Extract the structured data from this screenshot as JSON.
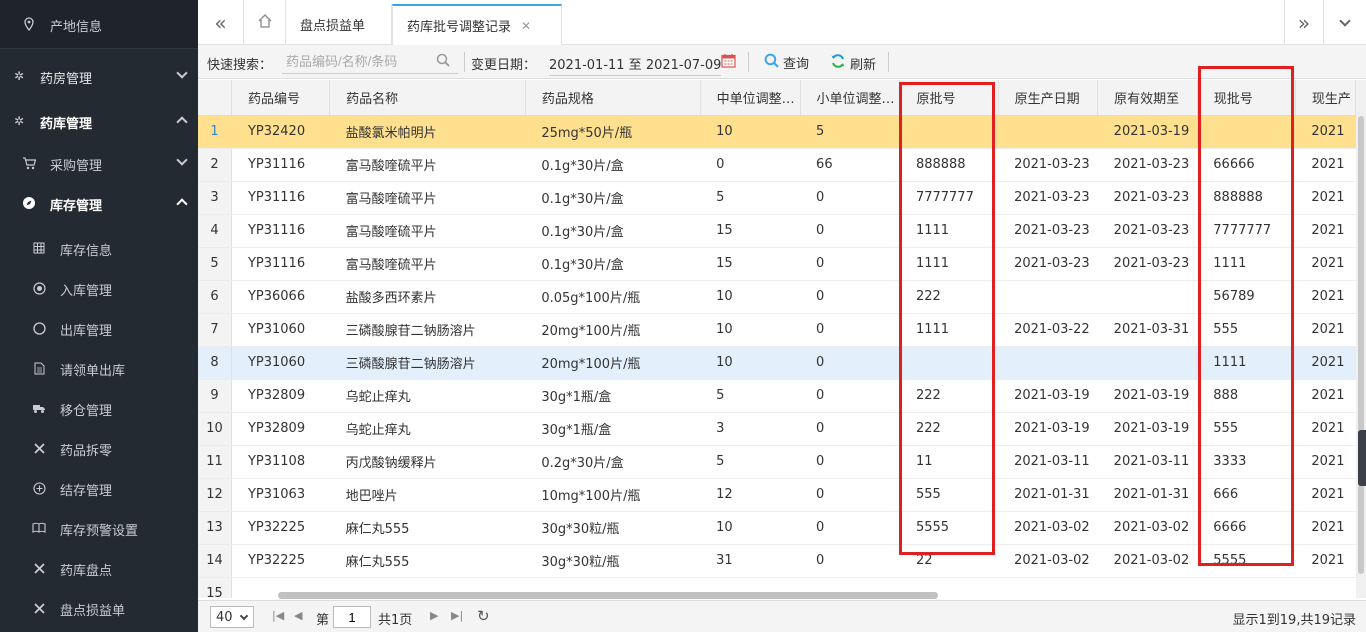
{
  "sidebar": {
    "top_item": "产地信息",
    "pharmacy": "药房管理",
    "warehouse": "药库管理",
    "purchase": "采购管理",
    "inventory": "库存管理",
    "children": [
      {
        "label": "库存信息",
        "icon": "grid-icon"
      },
      {
        "label": "入库管理",
        "icon": "radio-dot-icon"
      },
      {
        "label": "出库管理",
        "icon": "circle-icon"
      },
      {
        "label": "请领单出库",
        "icon": "document-icon"
      },
      {
        "label": "移仓管理",
        "icon": "truck-icon"
      },
      {
        "label": "药品拆零",
        "icon": "tools-icon"
      },
      {
        "label": "结存管理",
        "icon": "plus-circle-icon"
      },
      {
        "label": "库存预警设置",
        "icon": "book-icon"
      },
      {
        "label": "药库盘点",
        "icon": "tools-icon"
      },
      {
        "label": "盘点损益单",
        "icon": "tools-icon"
      }
    ]
  },
  "tabs": {
    "items": [
      "盘点损益单",
      "药库批号调整记录"
    ],
    "active": 1
  },
  "toolbar": {
    "search_label": "快速搜索：",
    "search_placeholder": "药品编码/名称/条码",
    "date_label": "变更日期：",
    "date_value": "2021-01-11 至 2021-07-09",
    "query": "查询",
    "refresh": "刷新"
  },
  "grid": {
    "columns": [
      "药品编号",
      "药品名称",
      "药品规格",
      "中单位调整…",
      "小单位调整…",
      "原批号",
      "原生产日期",
      "原有效期至",
      "现批号",
      "现生产"
    ],
    "rows": [
      {
        "n": "1",
        "cells": [
          "YP32420",
          "盐酸氯米帕明片",
          "25mg*50片/瓶",
          "10",
          "5",
          "",
          "",
          "2021-03-19",
          "",
          "2021"
        ]
      },
      {
        "n": "2",
        "cells": [
          "YP31116",
          "富马酸喹硫平片",
          "0.1g*30片/盒",
          "0",
          "66",
          "888888",
          "2021-03-23",
          "2021-03-23",
          "66666",
          "2021"
        ]
      },
      {
        "n": "3",
        "cells": [
          "YP31116",
          "富马酸喹硫平片",
          "0.1g*30片/盒",
          "5",
          "0",
          "7777777",
          "2021-03-23",
          "2021-03-23",
          "888888",
          "2021"
        ]
      },
      {
        "n": "4",
        "cells": [
          "YP31116",
          "富马酸喹硫平片",
          "0.1g*30片/盒",
          "15",
          "0",
          "1111",
          "2021-03-23",
          "2021-03-23",
          "7777777",
          "2021"
        ]
      },
      {
        "n": "5",
        "cells": [
          "YP31116",
          "富马酸喹硫平片",
          "0.1g*30片/盒",
          "15",
          "0",
          "1111",
          "2021-03-23",
          "2021-03-23",
          "1111",
          "2021"
        ]
      },
      {
        "n": "6",
        "cells": [
          "YP36066",
          "盐酸多西环素片",
          "0.05g*100片/瓶",
          "10",
          "0",
          "222",
          "",
          "",
          "56789",
          "2021"
        ]
      },
      {
        "n": "7",
        "cells": [
          "YP31060",
          "三磷酸腺苷二钠肠溶片",
          "20mg*100片/瓶",
          "10",
          "0",
          "1111",
          "2021-03-22",
          "2021-03-31",
          "555",
          "2021"
        ]
      },
      {
        "n": "8",
        "cells": [
          "YP31060",
          "三磷酸腺苷二钠肠溶片",
          "20mg*100片/瓶",
          "10",
          "0",
          "",
          "",
          "",
          "1111",
          "2021"
        ]
      },
      {
        "n": "9",
        "cells": [
          "YP32809",
          "乌蛇止痒丸",
          "30g*1瓶/盒",
          "5",
          "0",
          "222",
          "2021-03-19",
          "2021-03-19",
          "888",
          "2021"
        ]
      },
      {
        "n": "10",
        "cells": [
          "YP32809",
          "乌蛇止痒丸",
          "30g*1瓶/盒",
          "3",
          "0",
          "222",
          "2021-03-19",
          "2021-03-19",
          "555",
          "2021"
        ]
      },
      {
        "n": "11",
        "cells": [
          "YP31108",
          "丙戊酸钠缓释片",
          "0.2g*30片/盒",
          "5",
          "0",
          "11",
          "2021-03-11",
          "2021-03-11",
          "3333",
          "2021"
        ]
      },
      {
        "n": "12",
        "cells": [
          "YP31063",
          "地巴唑片",
          "10mg*100片/瓶",
          "12",
          "0",
          "555",
          "2021-01-31",
          "2021-01-31",
          "666",
          "2021"
        ]
      },
      {
        "n": "13",
        "cells": [
          "YP32225",
          "麻仁丸555",
          "30g*30粒/瓶",
          "10",
          "0",
          "5555",
          "2021-03-02",
          "2021-03-02",
          "6666",
          "2021"
        ]
      },
      {
        "n": "14",
        "cells": [
          "YP32225",
          "麻仁丸555",
          "30g*30粒/瓶",
          "31",
          "0",
          "22",
          "2021-03-02",
          "2021-03-02",
          "5555",
          "2021"
        ]
      },
      {
        "n": "15",
        "cells": [
          "",
          "",
          "",
          "",
          "",
          "",
          "",
          "",
          "",
          ""
        ]
      }
    ]
  },
  "pager": {
    "page_size": "40",
    "page_prefix": "第",
    "page_value": "1",
    "page_suffix": "共1页",
    "info": "显示1到19,共19记录"
  },
  "colors": {
    "sidebar_bg": "#232a31",
    "selected_row": "#fee08f",
    "hover_row": "#e3f0fb",
    "highlight_box": "#e02020",
    "tab_accent": "#3fa4e6"
  }
}
